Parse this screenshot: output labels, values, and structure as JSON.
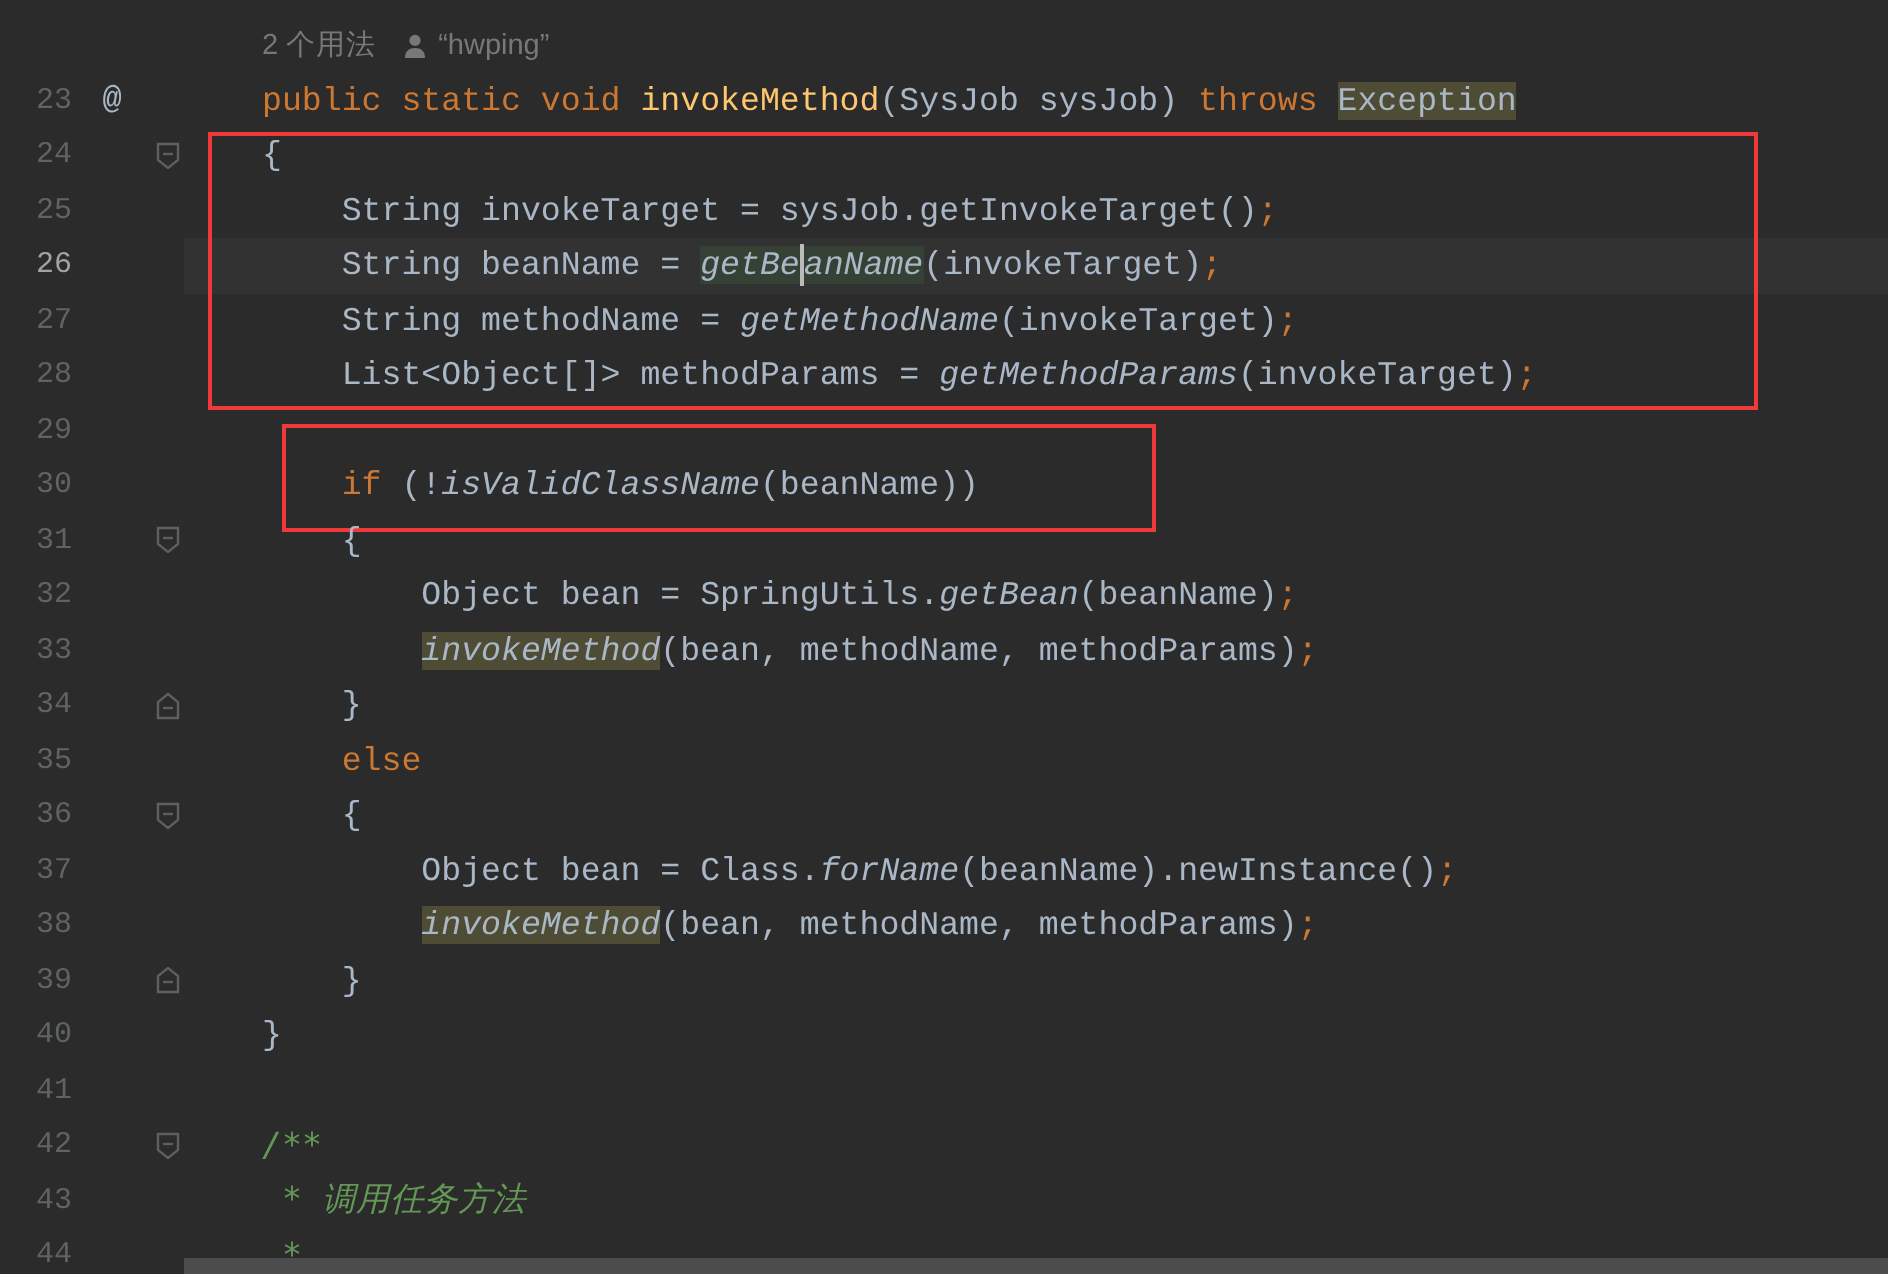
{
  "hint": {
    "usages": "2 个用法",
    "author": "“hwping”"
  },
  "lines": [
    {
      "number": "23",
      "marker": "@",
      "tokens": [
        {
          "t": "public static void",
          "kind": "keyword"
        },
        {
          "t": "invokeMethod",
          "kind": "declaration"
        },
        {
          "t": "(SysJob sysJob) ",
          "kind": "plain"
        },
        {
          "t": "throws",
          "kind": "keyword"
        },
        {
          "t": "Exception",
          "kind": "plain",
          "highlighted": true
        }
      ]
    },
    {
      "number": "24",
      "fold_start": true,
      "boxed": true,
      "tokens": [
        {
          "t": "{",
          "kind": "plain"
        }
      ],
      "children": [
        {
          "number": "25",
          "boxed": true,
          "tokens": [
            {
              "t": "String invokeTarget = sysJob.getInvokeTarget()",
              "kind": "plain"
            },
            {
              "t": ";",
              "kind": "punctuation"
            }
          ]
        },
        {
          "number": "26",
          "boxed": true,
          "current": true,
          "tokens": [
            {
              "t": "String beanName = ",
              "kind": "plain"
            },
            {
              "t": "getBe",
              "kind": "call",
              "highlighted": true,
              "caret": true
            },
            {
              "t": "anName",
              "kind": "call",
              "highlighted": true
            },
            {
              "t": "(invokeTarget)",
              "kind": "plain"
            },
            {
              "t": ";",
              "kind": "punctuation"
            }
          ]
        },
        {
          "number": "27",
          "boxed": true,
          "tokens": [
            {
              "t": "String methodName = ",
              "kind": "plain"
            },
            {
              "t": "getMethodName",
              "kind": "call"
            },
            {
              "t": "(invokeTarget)",
              "kind": "plain"
            },
            {
              "t": ";",
              "kind": "punctuation"
            }
          ]
        },
        {
          "number": "28",
          "boxed": true,
          "tokens": [
            {
              "t": "List<Object[]> methodParams = ",
              "kind": "plain"
            },
            {
              "t": "getMethodParams",
              "kind": "call"
            },
            {
              "t": "(invokeTarget)",
              "kind": "plain"
            },
            {
              "t": ";",
              "kind": "punctuation"
            }
          ]
        },
        {
          "number": "29"
        },
        {
          "number": "30",
          "boxed": true,
          "tokens": [
            {
              "t": "if",
              "kind": "keyword"
            },
            {
              "t": " (!",
              "kind": "plain"
            },
            {
              "t": "isValidClassName",
              "kind": "call"
            },
            {
              "t": "(beanName))",
              "kind": "plain"
            }
          ]
        },
        {
          "number": "31",
          "fold_start": true,
          "tokens": [
            {
              "t": "{",
              "kind": "plain"
            }
          ],
          "children": [
            {
              "number": "32",
              "tokens": [
                {
                  "t": "Object bean = SpringUtils.",
                  "kind": "plain"
                },
                {
                  "t": "getBean",
                  "kind": "call"
                },
                {
                  "t": "(beanName)",
                  "kind": "plain"
                },
                {
                  "t": ";",
                  "kind": "punctuation"
                }
              ]
            },
            {
              "number": "33",
              "tokens": [
                {
                  "t": "invokeMethod",
                  "kind": "call",
                  "highlighted": true
                },
                {
                  "t": "(bean, methodName, methodParams)",
                  "kind": "plain"
                },
                {
                  "t": ";",
                  "kind": "punctuation"
                }
              ]
            }
          ]
        },
        {
          "number": "34",
          "fold_end": true,
          "tokens": [
            {
              "t": "}",
              "kind": "plain"
            }
          ]
        },
        {
          "number": "35",
          "tokens": [
            {
              "t": "else",
              "kind": "keyword"
            }
          ]
        },
        {
          "number": "36",
          "fold_start": true,
          "tokens": [
            {
              "t": "{",
              "kind": "plain"
            }
          ],
          "children": [
            {
              "number": "37",
              "tokens": [
                {
                  "t": "Object bean = Class.",
                  "kind": "plain"
                },
                {
                  "t": "forName",
                  "kind": "call"
                },
                {
                  "t": "(beanName).newInstance()",
                  "kind": "plain"
                },
                {
                  "t": ";",
                  "kind": "punctuation"
                }
              ]
            },
            {
              "number": "38",
              "tokens": [
                {
                  "t": "invokeMethod",
                  "kind": "call",
                  "highlighted": true
                },
                {
                  "t": "(bean, methodName, methodParams)",
                  "kind": "plain"
                },
                {
                  "t": ";",
                  "kind": "punctuation"
                }
              ]
            }
          ]
        },
        {
          "number": "39",
          "fold_end": true,
          "tokens": [
            {
              "t": "}",
              "kind": "plain"
            }
          ]
        }
      ]
    },
    {
      "number": "40",
      "tokens": [
        {
          "t": "}",
          "kind": "plain"
        }
      ]
    },
    {
      "number": "41"
    },
    {
      "number": "42",
      "fold_start": true,
      "tokens": [
        {
          "t": "/**",
          "kind": "comment"
        }
      ]
    },
    {
      "number": "43",
      "tokens": [
        {
          "t": "* 调用任务方法",
          "kind": "doc-continuation"
        }
      ]
    },
    {
      "number": "44",
      "tokens": [
        {
          "t": "*",
          "kind": "doc-continuation"
        }
      ]
    }
  ]
}
